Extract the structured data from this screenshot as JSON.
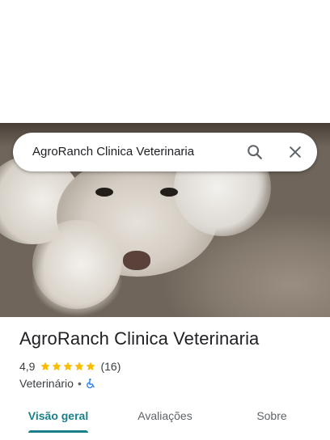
{
  "search": {
    "query": "AgroRanch Clinica Veterinaria"
  },
  "place": {
    "name": "AgroRanch Clinica Veterinaria",
    "rating": "4,9",
    "rating_value": 4.9,
    "stars_filled": 5,
    "review_count": "(16)",
    "category": "Veterinário",
    "separator": "•",
    "accessibility_icon": "wheelchair-icon"
  },
  "tabs": [
    {
      "label": "Visão geral",
      "active": true
    },
    {
      "label": "Avaliações",
      "active": false
    },
    {
      "label": "Sobre",
      "active": false
    }
  ],
  "colors": {
    "accent": "#1a7f8a",
    "star": "#fbbc04",
    "accessibility": "#1a73e8",
    "text_primary": "#202124",
    "text_secondary": "#3c4043"
  }
}
